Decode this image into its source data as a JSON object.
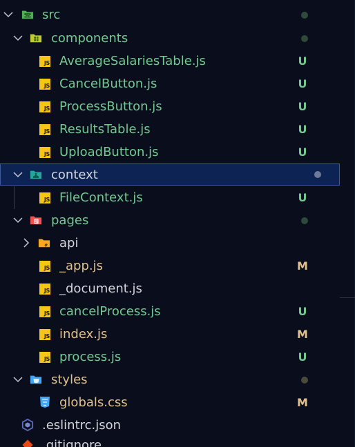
{
  "tree": {
    "src": {
      "label": "src",
      "status_dot": true
    },
    "components": {
      "label": "components",
      "status_dot": true
    },
    "components_files": [
      {
        "label": "AverageSalariesTable.js",
        "status": "U"
      },
      {
        "label": "CancelButton.js",
        "status": "U"
      },
      {
        "label": "ProcessButton.js",
        "status": "U"
      },
      {
        "label": "ResultsTable.js",
        "status": "U"
      },
      {
        "label": "UploadButton.js",
        "status": "U"
      }
    ],
    "context": {
      "label": "context",
      "status_dot": true
    },
    "context_files": [
      {
        "label": "FileContext.js",
        "status": "U"
      }
    ],
    "pages": {
      "label": "pages",
      "status_dot": true
    },
    "api": {
      "label": "api"
    },
    "pages_files": [
      {
        "label": "_app.js",
        "status": "M"
      },
      {
        "label": "_document.js",
        "status": ""
      },
      {
        "label": "cancelProcess.js",
        "status": "U"
      },
      {
        "label": "index.js",
        "status": "M"
      },
      {
        "label": "process.js",
        "status": "U"
      }
    ],
    "styles": {
      "label": "styles",
      "status_dot": true
    },
    "styles_files": [
      {
        "label": "globals.css",
        "status": "M"
      }
    ],
    "root_files": [
      {
        "label": ".eslintrc.json"
      },
      {
        "label": ".gitignore"
      }
    ]
  },
  "icons": {
    "js_file": "js-file-icon",
    "css_file": "css-file-icon",
    "src_folder": "src-folder-icon",
    "components_folder": "components-folder-icon",
    "context_folder": "context-folder-icon",
    "pages_folder": "pages-folder-icon",
    "api_folder": "api-folder-icon",
    "styles_folder": "styles-folder-icon",
    "eslint": "eslint-icon",
    "git": "git-icon"
  },
  "colors": {
    "background": "#0a0e1c",
    "selected_bg": "#0c2353",
    "selected_border": "#3e5a9a",
    "untracked": "#73c991",
    "modified": "#e2c08d",
    "plain_text": "#d4d6dc",
    "js_badge": "#f5c518"
  }
}
